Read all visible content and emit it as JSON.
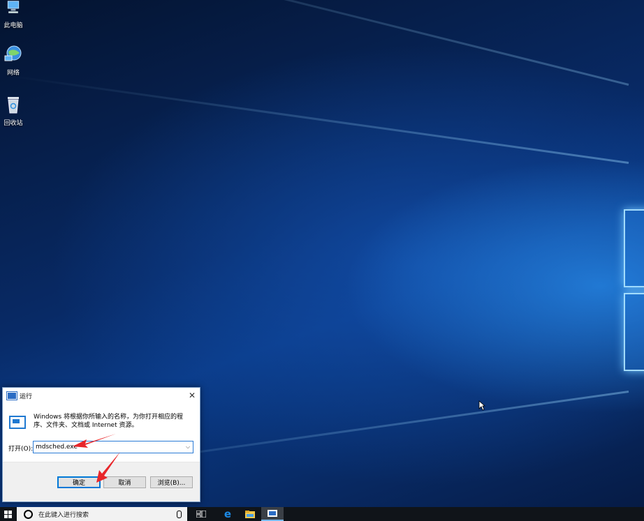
{
  "desktop": {
    "icons": [
      {
        "label": "此电脑",
        "icon": "computer-icon"
      },
      {
        "label": "网络",
        "icon": "network-icon"
      },
      {
        "label": "回收站",
        "icon": "recycle-bin-icon"
      }
    ]
  },
  "run_dialog": {
    "title": "运行",
    "description": "Windows 将根据你所输入的名称，为你打开相应的程序、文件夹、文档或 Internet 资源。",
    "open_label": "打开(O):",
    "input_value": "mdsched.exe",
    "ok_label": "确定",
    "cancel_label": "取消",
    "browse_label": "浏览(B)..."
  },
  "taskbar": {
    "search_placeholder": "在此键入进行搜索"
  },
  "colors": {
    "accent": "#0078d7",
    "annotation_arrow": "#e8262a"
  }
}
